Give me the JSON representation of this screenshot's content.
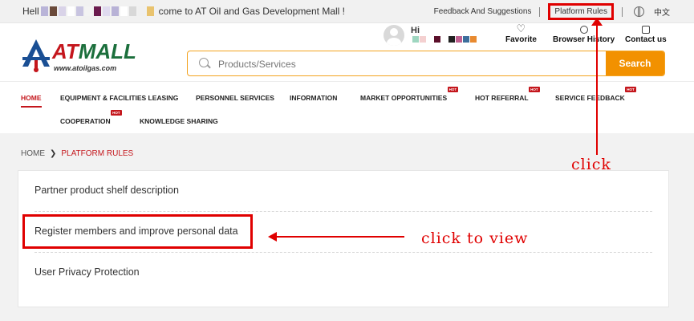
{
  "topbar": {
    "greeting_prefix": "Hell",
    "greeting_suffix": "come to AT Oil and Gas Development Mall !",
    "feedback_link": "Feedback And Suggestions",
    "rules_link": "Platform Rules",
    "language": "中文"
  },
  "header": {
    "logo_text_at": "AT",
    "logo_text_mall": "MALL",
    "logo_url": "www.atoilgas.com",
    "search_placeholder": "Products/Services",
    "search_button": "Search",
    "user_hi": "Hi",
    "favorite": "Favorite",
    "browser_history": "Browser History",
    "contact_us": "Contact us"
  },
  "nav": {
    "items": [
      {
        "label": "HOME"
      },
      {
        "label": "EQUIPMENT & FACILITIES LEASING"
      },
      {
        "label": "PERSONNEL SERVICES"
      },
      {
        "label": "INFORMATION"
      },
      {
        "label": "MARKET OPPORTUNITIES"
      },
      {
        "label": "HOT REFERRAL"
      },
      {
        "label": "SERVICE FEEDBACK"
      },
      {
        "label": "COOPERATION"
      },
      {
        "label": "KNOWLEDGE SHARING"
      }
    ],
    "hot_badge": "HOT"
  },
  "breadcrumb": {
    "home": "HOME",
    "current": "PLATFORM RULES"
  },
  "rules": [
    {
      "title": "Partner product shelf description"
    },
    {
      "title": "Register members and improve personal data"
    },
    {
      "title": "User Privacy Protection"
    }
  ],
  "annotations": {
    "click": "click",
    "click_to_view": "click to view",
    "color": "#e00000"
  },
  "colors": {
    "brand_red": "#c4161c",
    "brand_green": "#1b6f3c",
    "search_orange": "#f29100"
  }
}
